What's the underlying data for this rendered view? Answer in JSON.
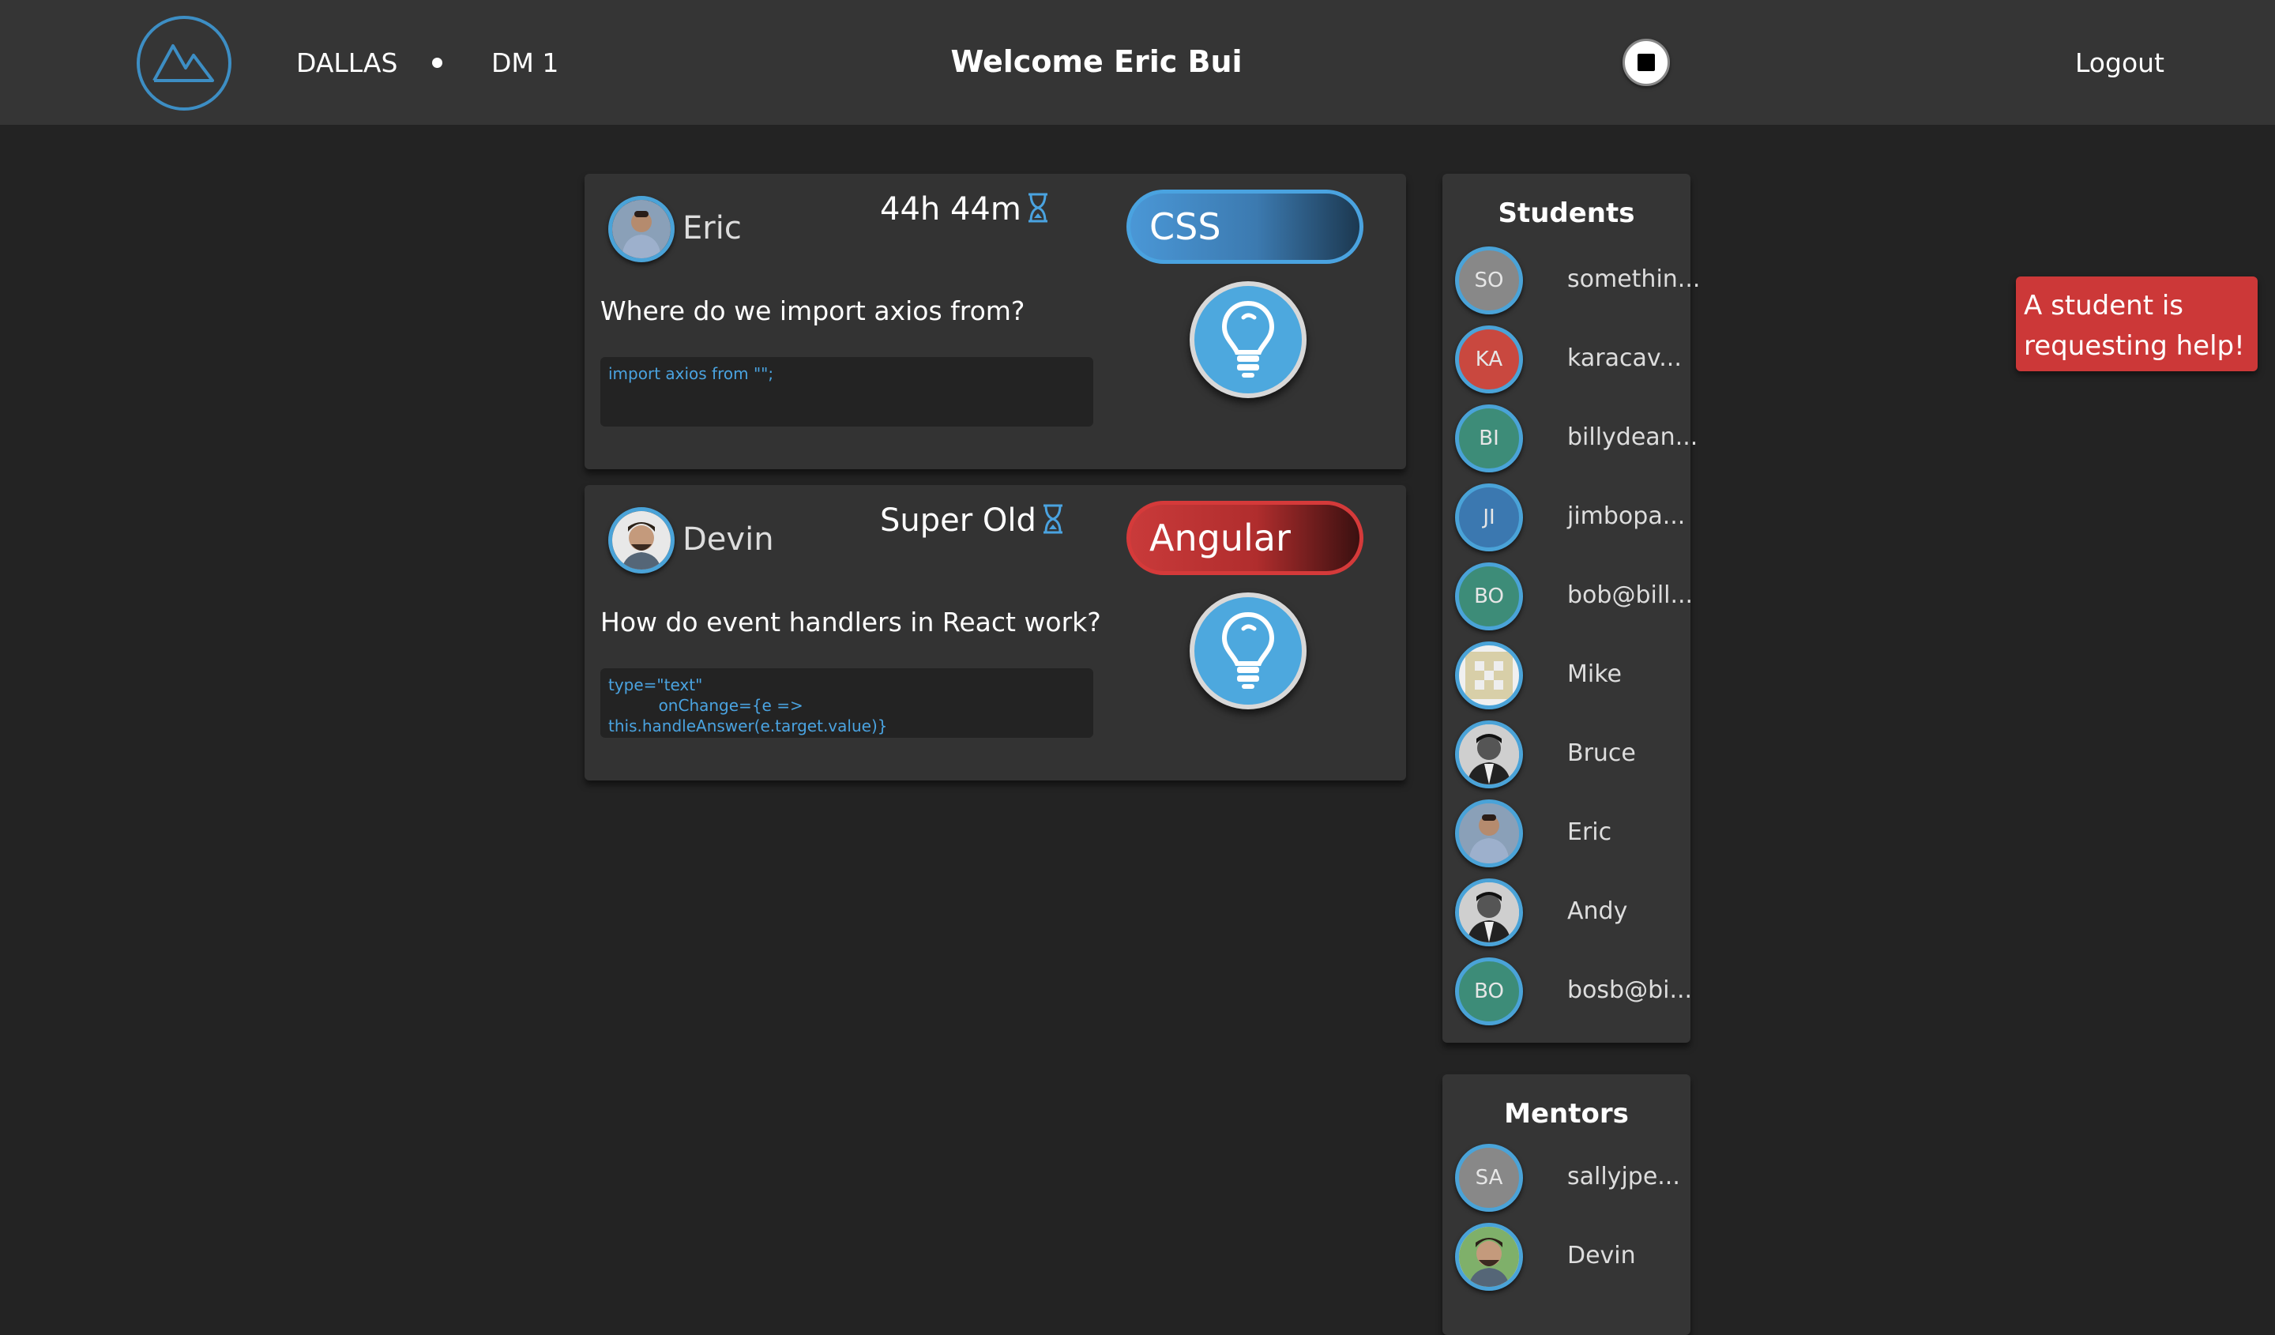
{
  "nav": {
    "location": "DALLAS",
    "cohort": "DM 1",
    "welcome": "Welcome Eric Bui",
    "logout": "Logout"
  },
  "queue": [
    {
      "name": "Eric",
      "time": "44h 44m",
      "tag": "CSS",
      "question": "Where do we import axios from?",
      "code": "import axios from \"\";"
    },
    {
      "name": "Devin",
      "time": "Super Old",
      "tag": "Angular",
      "question": "How do event handlers in React work?",
      "code": "type=\"text\"\n          onChange={e =>\nthis.handleAnswer(e.target.value)}"
    }
  ],
  "students": {
    "title": "Students",
    "items": [
      {
        "initials": "SO",
        "name": "somethin..."
      },
      {
        "initials": "KA",
        "name": "karacav..."
      },
      {
        "initials": "BI",
        "name": "billydean..."
      },
      {
        "initials": "JI",
        "name": "jimbopa..."
      },
      {
        "initials": "BO",
        "name": "bob@bill..."
      },
      {
        "initials": "",
        "name": "Mike"
      },
      {
        "initials": "",
        "name": "Bruce"
      },
      {
        "initials": "",
        "name": "Eric"
      },
      {
        "initials": "",
        "name": "Andy"
      },
      {
        "initials": "BO",
        "name": "bosb@bi..."
      }
    ]
  },
  "mentors": {
    "title": "Mentors",
    "items": [
      {
        "initials": "SA",
        "name": "sallyjpe..."
      },
      {
        "initials": "",
        "name": "Devin"
      }
    ]
  },
  "toast": {
    "message": "A student is requesting help!"
  },
  "colors": {
    "background": "#232323",
    "nav": "#353535",
    "accent_blue": "#4aa3d8",
    "accent_red": "#cc3838"
  },
  "icons": [
    "mountain-logo-icon",
    "stop-icon",
    "hourglass-icon",
    "lightbulb-icon"
  ]
}
